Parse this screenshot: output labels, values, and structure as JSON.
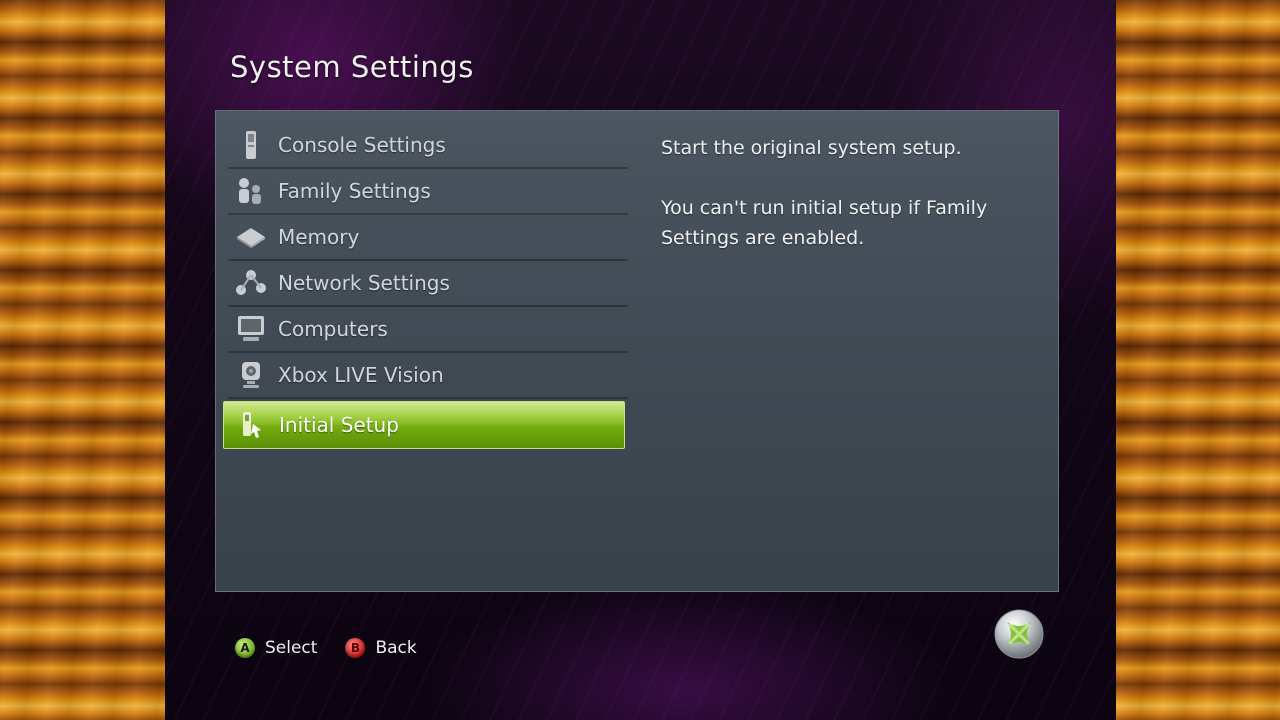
{
  "screen_title": "System Settings",
  "menu": {
    "items": [
      {
        "label": "Console Settings",
        "icon": "console-icon"
      },
      {
        "label": "Family Settings",
        "icon": "family-icon"
      },
      {
        "label": "Memory",
        "icon": "memory-icon"
      },
      {
        "label": "Network Settings",
        "icon": "network-icon"
      },
      {
        "label": "Computers",
        "icon": "computer-icon"
      },
      {
        "label": "Xbox LIVE Vision",
        "icon": "camera-icon"
      },
      {
        "label": "Initial Setup",
        "icon": "setup-icon",
        "selected": true
      }
    ]
  },
  "description": {
    "line1": "Start the original system setup.",
    "line2": "You can't run initial setup if Family Settings are enabled."
  },
  "footer": {
    "a_glyph": "A",
    "a_label": "Select",
    "b_glyph": "B",
    "b_label": "Back"
  },
  "logo": "xbox-logo-icon",
  "colors": {
    "selected_green": "#8cc21c",
    "panel": "#434d57",
    "a_button": "#6fb01a",
    "b_button": "#c81818"
  }
}
